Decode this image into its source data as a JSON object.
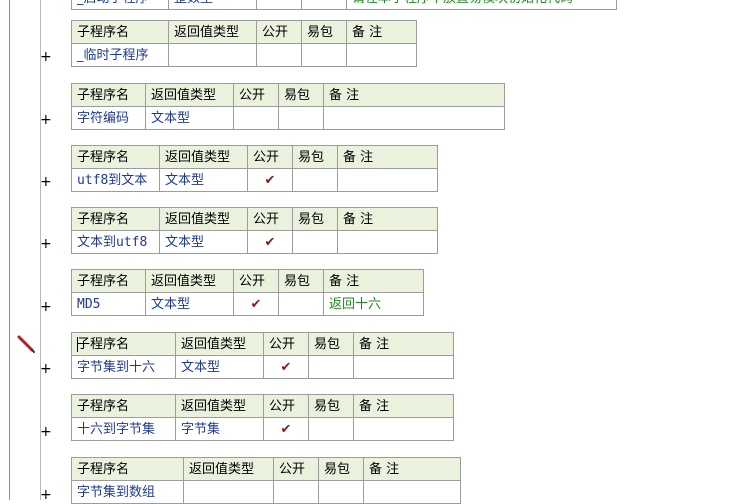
{
  "headers": {
    "name": "子程序名",
    "ret": "返回值类型",
    "pub": "公开",
    "easy": "易包",
    "note": "备 注"
  },
  "expand_symbol": "+",
  "check_mark": "✔",
  "top_partial": {
    "name": "_启动子程序",
    "ret": "整数型",
    "note": "请在本子程序中放置易模块初始化代码"
  },
  "subs": [
    {
      "name": "_临时子程序",
      "ret": "",
      "pub": "",
      "easy": "",
      "note": ""
    },
    {
      "name": "字符编码",
      "ret": "文本型",
      "pub": "",
      "easy": "",
      "note": ""
    },
    {
      "name": "utf8到文本",
      "ret": "文本型",
      "pub": "✔",
      "easy": "",
      "note": ""
    },
    {
      "name": "文本到utf8",
      "ret": "文本型",
      "pub": "✔",
      "easy": "",
      "note": ""
    },
    {
      "name": "MD5",
      "ret": "文本型",
      "pub": "✔",
      "easy": "",
      "note": "返回十六"
    },
    {
      "name": "字节集到十六",
      "ret": "文本型",
      "pub": "✔",
      "easy": "",
      "note": ""
    },
    {
      "name": "十六到字节集",
      "ret": "字节集",
      "pub": "✔",
      "easy": "",
      "note": ""
    },
    {
      "name": "字节集到数组",
      "ret": "",
      "pub": "",
      "easy": "",
      "note": ""
    }
  ]
}
